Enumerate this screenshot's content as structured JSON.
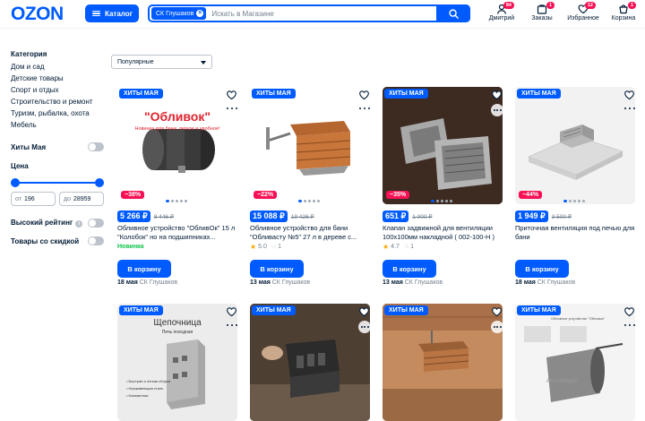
{
  "header": {
    "logo": "OZON",
    "catalog_label": "Каталог",
    "search_chip": "СК Глушаков",
    "search_placeholder": "Искать в Магазине",
    "icons": [
      {
        "name": "user-icon",
        "label": "Дмитрий",
        "badge": "84"
      },
      {
        "name": "orders-icon",
        "label": "Заказы",
        "badge": "1"
      },
      {
        "name": "favorites-icon",
        "label": "Избранное",
        "badge": "12"
      },
      {
        "name": "cart-icon",
        "label": "Корзина",
        "badge": "1"
      }
    ]
  },
  "sidebar": {
    "category_title": "Категория",
    "categories": [
      "Дом и сад",
      "Детские товары",
      "Спорт и отдых",
      "Строительство и ремонт",
      "Туризм, рыбалка, охота",
      "Мебель"
    ],
    "hits_label": "Хиты Мая",
    "price_title": "Цена",
    "price_from_prefix": "от",
    "price_from": "196",
    "price_to_prefix": "до",
    "price_to": "28959",
    "high_rating_label": "Высокий рейтинг",
    "discount_label": "Товары со скидкой"
  },
  "sort": {
    "selected": "Популярные"
  },
  "products": [
    {
      "badge": "ХИТЫ МАЯ",
      "discount": "−38%",
      "price": "5 266 ₽",
      "old_price": "8 446 ₽",
      "name": "Обливное устройство \"ОбливОк\" 15 л \"Колобок\" но на подшипниках...",
      "extra": "Новинка",
      "rating": "",
      "reviews": "",
      "buy": "В корзину",
      "date": "18 мая",
      "store": "СК Глушаков"
    },
    {
      "badge": "ХИТЫ МАЯ",
      "discount": "−22%",
      "price": "15 088 ₽",
      "old_price": "19 426 ₽",
      "name": "Обливное устройство для бани \"Обливасту №5\" 27 л в деревe с...",
      "extra": "",
      "rating": "5.0",
      "reviews": "1",
      "buy": "В корзину",
      "date": "13 мая",
      "store": "СК Глушаков"
    },
    {
      "badge": "ХИТЫ МАЯ",
      "discount": "−35%",
      "price": "651 ₽",
      "old_price": "1 000 ₽",
      "name": "Клапан задвижной для вентиляции 100х100мм накладной ( 002-100-Н )",
      "extra": "",
      "rating": "4.7",
      "reviews": "1",
      "buy": "В корзину",
      "date": "13 мая",
      "store": "СК Глушаков"
    },
    {
      "badge": "ХИТЫ МАЯ",
      "discount": "−44%",
      "price": "1 949 ₽",
      "old_price": "3 500 ₽",
      "name": "Приточная вентиляция под печью для бани",
      "extra": "",
      "rating": "",
      "reviews": "",
      "buy": "В корзину",
      "date": "18 мая",
      "store": "СК Глушаков"
    },
    {
      "badge": "ХИТЫ МАЯ",
      "image_title": "Щепочница",
      "image_subtitle": "Печь походная",
      "image_list": [
        "• Быстрая и легкая сборка",
        "• Нержавеющая сталь",
        "• Компактная"
      ]
    },
    {
      "badge": "ХИТЫ МАЯ"
    },
    {
      "badge": "ХИТЫ МАЯ"
    },
    {
      "badge": "ХИТЫ МАЯ",
      "image_title": "Обливное устройство \"Обливок\"",
      "image_caption": "Активация"
    }
  ],
  "product1_image_text": "\"Обливок\"",
  "product1_image_sub": "Новинка для бани, легкое и удобное!",
  "colors": {
    "brand": "#005bff",
    "sale": "#f91155",
    "novelty": "#10c44c"
  }
}
